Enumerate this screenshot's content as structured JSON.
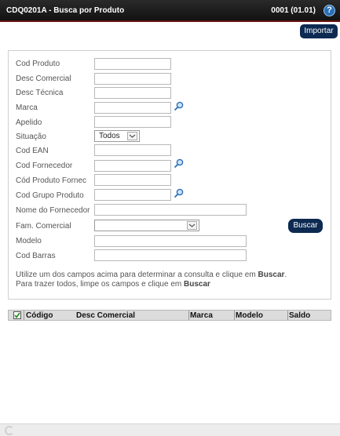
{
  "header": {
    "title": "CDQ0201A - Busca por Produto",
    "code": "0001 (01.01)",
    "help_icon": "help-icon",
    "help_glyph": "?"
  },
  "toolbar": {
    "import_label": "Importar"
  },
  "form": {
    "cod_produto": "Cod Produto",
    "desc_comercial": "Desc Comercial",
    "desc_tecnica": "Desc Técnica",
    "marca": "Marca",
    "apelido": "Apelido",
    "situacao": "Situação",
    "situacao_value": "Todos",
    "cod_ean": "Cod EAN",
    "cod_fornecedor": "Cod Fornecedor",
    "cod_produto_fornec": "Cód Produto Fornec",
    "cod_grupo_produto": "Cod Grupo Produto",
    "nome_fornecedor": "Nome do Fornecedor",
    "fam_comercial": "Fam. Comercial",
    "modelo": "Modelo",
    "cod_barras": "Cod Barras",
    "search_label": "Buscar"
  },
  "hint": {
    "line1_prefix": "Utilize um dos campos acima para determinar a consulta e clique em ",
    "line1_bold": "Buscar",
    "line1_suffix": ".",
    "line2_prefix": "Para trazer todos, limpe os campos e clique em ",
    "line2_bold": "Buscar"
  },
  "table": {
    "columns": [
      "Código",
      "Desc Comercial",
      "Marca",
      "Modelo",
      "Saldo"
    ],
    "select_all_checked": true
  },
  "colors": {
    "title_bg": "#1a1a1a",
    "button_bg": "#0d2a52",
    "help_bg": "#2a6fb8",
    "lookup_icon": "#2a6fb8"
  }
}
